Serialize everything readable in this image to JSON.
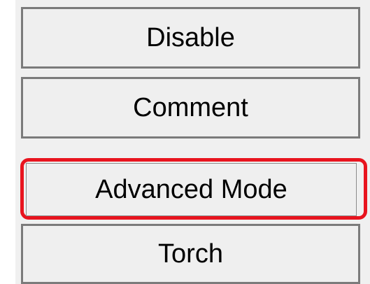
{
  "buttons": {
    "disable_label": "Disable",
    "comment_label": "Comment",
    "advanced_mode_label": "Advanced Mode",
    "torch_label": "Torch"
  },
  "colors": {
    "panel_background": "#f0f0f0",
    "button_face": "#efefef",
    "button_border": "#7b7b7b",
    "highlight": "#e8141e",
    "text": "#000000"
  }
}
